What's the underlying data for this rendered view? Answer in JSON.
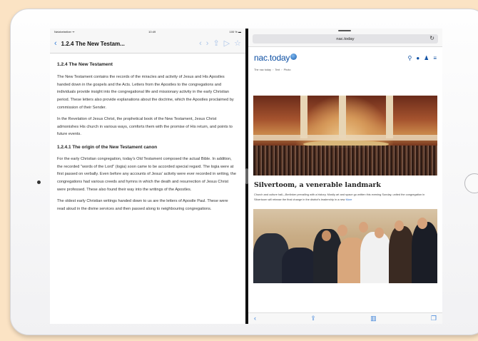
{
  "device": {
    "home_button": "home-button",
    "camera": "front-camera"
  },
  "left_app": {
    "status": {
      "carrier": "Netzbetreiber ᯤ",
      "time": "10:49",
      "battery": "100 % ▬"
    },
    "navbar": {
      "back_icon": "chevron-left-icon",
      "title": "1.2.4 The New Testam...",
      "icons": [
        "chevron-left-icon",
        "chevron-right-icon",
        "share-icon",
        "bookmark-forward-icon",
        "star-icon"
      ]
    },
    "document": {
      "heading": "1.2.4 The New Testament",
      "p1": "The New Testament contains the records of the miracles and activity of Jesus and His Apostles handed down in the gospels and the Acts. Letters from the Apostles to the congregations and individuals provide insight into the congregational life and missionary activity in the early Christian period. These letters also provide explanations about the doctrine, which the Apostles proclaimed by commission of their Sender.",
      "p2": "In the Revelation of Jesus Christ, the prophetical book of the New Testament, Jesus Christ admonishes His church in various ways, comforts them with the promise of His return, and points to future events.",
      "subheading": "1.2.4.1 The origin of the New Testament canon",
      "p3": "For the early Christian congregation, today's Old Testament composed the actual Bible. In addition, the recorded \"words of the Lord\" (logia) soon came to be accorded special regard. The logia were at first passed on verbally. Even before any accounts of Jesus' activity were ever recorded in writing, the congregations had various creeds and hymns in which the death and resurrection of Jesus Christ were professed. These also found their way into the writings of the Apostles.",
      "p4": "The oldest early Christian writings handed down to us are the letters of Apostle Paul. These were read aloud in the divine services and then passed along to neighbouring congregations."
    }
  },
  "right_app": {
    "url": "nac.today",
    "reload_icon": "reload-icon",
    "site": {
      "logo_text": "nac.today",
      "icons": [
        "search-icon",
        "globe-icon",
        "user-icon",
        "menu-icon"
      ],
      "breadcrumb": [
        "The nac today",
        "Text",
        "Photo"
      ]
    },
    "article": {
      "title": "Silvertoom, a venerable landmark",
      "body": "Church and culture hall—Berlinker prevailing with a history. Mostly art and space go written this evening Sunday, united the congregation in Silvertoom will release the final change in the district's leadership in a new ",
      "more": "More"
    },
    "toolbar_icons": [
      "back-icon",
      "share-icon",
      "bookmarks-icon",
      "tabs-icon"
    ]
  }
}
